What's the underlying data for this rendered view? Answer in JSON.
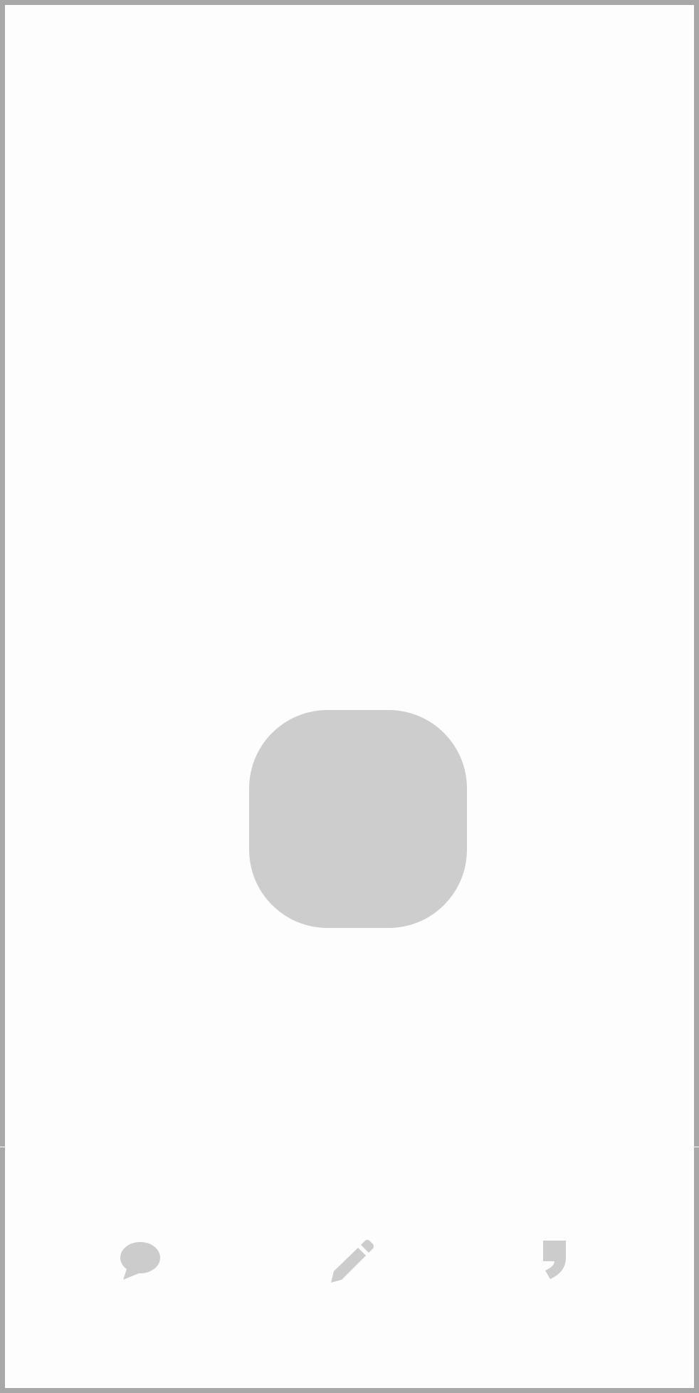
{
  "colors": {
    "frame_border": "#a8a8a8",
    "background": "#fdfdfd",
    "placeholder": "#cdcdcd",
    "icon": "#cccccc"
  },
  "main": {
    "image_placeholder": {
      "icon": "rounded-square-placeholder"
    }
  },
  "tab_bar": {
    "tabs": [
      {
        "id": "comment",
        "icon": "speech-bubble-icon"
      },
      {
        "id": "edit",
        "icon": "pencil-icon"
      },
      {
        "id": "quote",
        "icon": "quote-icon"
      }
    ]
  }
}
